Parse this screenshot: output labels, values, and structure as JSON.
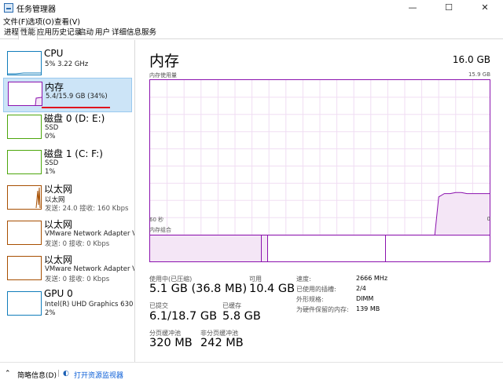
{
  "window": {
    "title": "任务管理器",
    "minimize_icon": "minimize-icon",
    "maximize_icon": "maximize-icon",
    "close_icon": "close-icon"
  },
  "menu": [
    "文件(F)",
    "选项(O)",
    "查看(V)"
  ],
  "tabs": [
    "进程",
    "性能",
    "应用历史记录",
    "启动",
    "用户",
    "详细信息",
    "服务"
  ],
  "active_tab": "性能",
  "sidebar": {
    "items": [
      {
        "name": "CPU",
        "line1": "5% 3.22 GHz",
        "line2": "",
        "color": "#117dbb"
      },
      {
        "name": "内存",
        "line1": "5.4/15.9 GB (34%)",
        "line2": "",
        "color": "#8b12ae"
      },
      {
        "name": "磁盘 0 (D: E:)",
        "line1": "SSD",
        "line2": "0%",
        "color": "#4da60c"
      },
      {
        "name": "磁盘 1 (C: F:)",
        "line1": "SSD",
        "line2": "1%",
        "color": "#4da60c"
      },
      {
        "name": "以太网",
        "line1": "以太网",
        "line2": "发送: 24.0  接收: 160 Kbps",
        "color": "#a74f01"
      },
      {
        "name": "以太网",
        "line1": "VMware Network Adapter V...",
        "line2": "发送: 0  接收: 0 Kbps",
        "color": "#a74f01"
      },
      {
        "name": "以太网",
        "line1": "VMware Network Adapter V...",
        "line2": "发送: 0  接收: 0 Kbps",
        "color": "#a74f01"
      },
      {
        "name": "GPU 0",
        "line1": "Intel(R) UHD Graphics 630",
        "line2": "2%",
        "color": "#117dbb"
      }
    ]
  },
  "main": {
    "title": "内存",
    "total": "16.0 GB",
    "usage_label": "内存使用量",
    "usage_max": "15.9 GB",
    "time_left": "60 秒",
    "time_right": "0",
    "composition_label": "内存组合",
    "accent": "#8b12ae",
    "fill": "#f4e6f6"
  },
  "stats": {
    "in_use_label": "使用中(已压缩)",
    "in_use": "5.1 GB (36.8 MB)",
    "available_label": "可用",
    "available": "10.4 GB",
    "committed_label": "已提交",
    "committed": "6.1/18.7 GB",
    "cached_label": "已缓存",
    "cached": "5.8 GB",
    "paged_label": "分页缓冲池",
    "paged": "320 MB",
    "nonpaged_label": "非分页缓冲池",
    "nonpaged": "242 MB"
  },
  "specs": [
    {
      "label": "速度:",
      "value": "2666 MHz"
    },
    {
      "label": "已使用的插槽:",
      "value": "2/4"
    },
    {
      "label": "外形规格:",
      "value": "DIMM"
    },
    {
      "label": "为硬件保留的内存:",
      "value": "139 MB"
    }
  ],
  "chart_data": {
    "type": "area",
    "title": "内存使用量",
    "x": [
      60,
      10,
      9,
      8,
      7,
      6,
      5,
      4,
      3,
      2,
      1,
      0
    ],
    "values": [
      0,
      0,
      5.1,
      5.4,
      5.4,
      5.5,
      5.5,
      5.4,
      5.4,
      5.4,
      5.4,
      5.4
    ],
    "ylim": [
      0,
      15.9
    ],
    "xlabel": "",
    "ylabel": "",
    "grid": true
  },
  "footer": {
    "brief": "简略信息(D)",
    "monitor": "打开资源监视器"
  }
}
